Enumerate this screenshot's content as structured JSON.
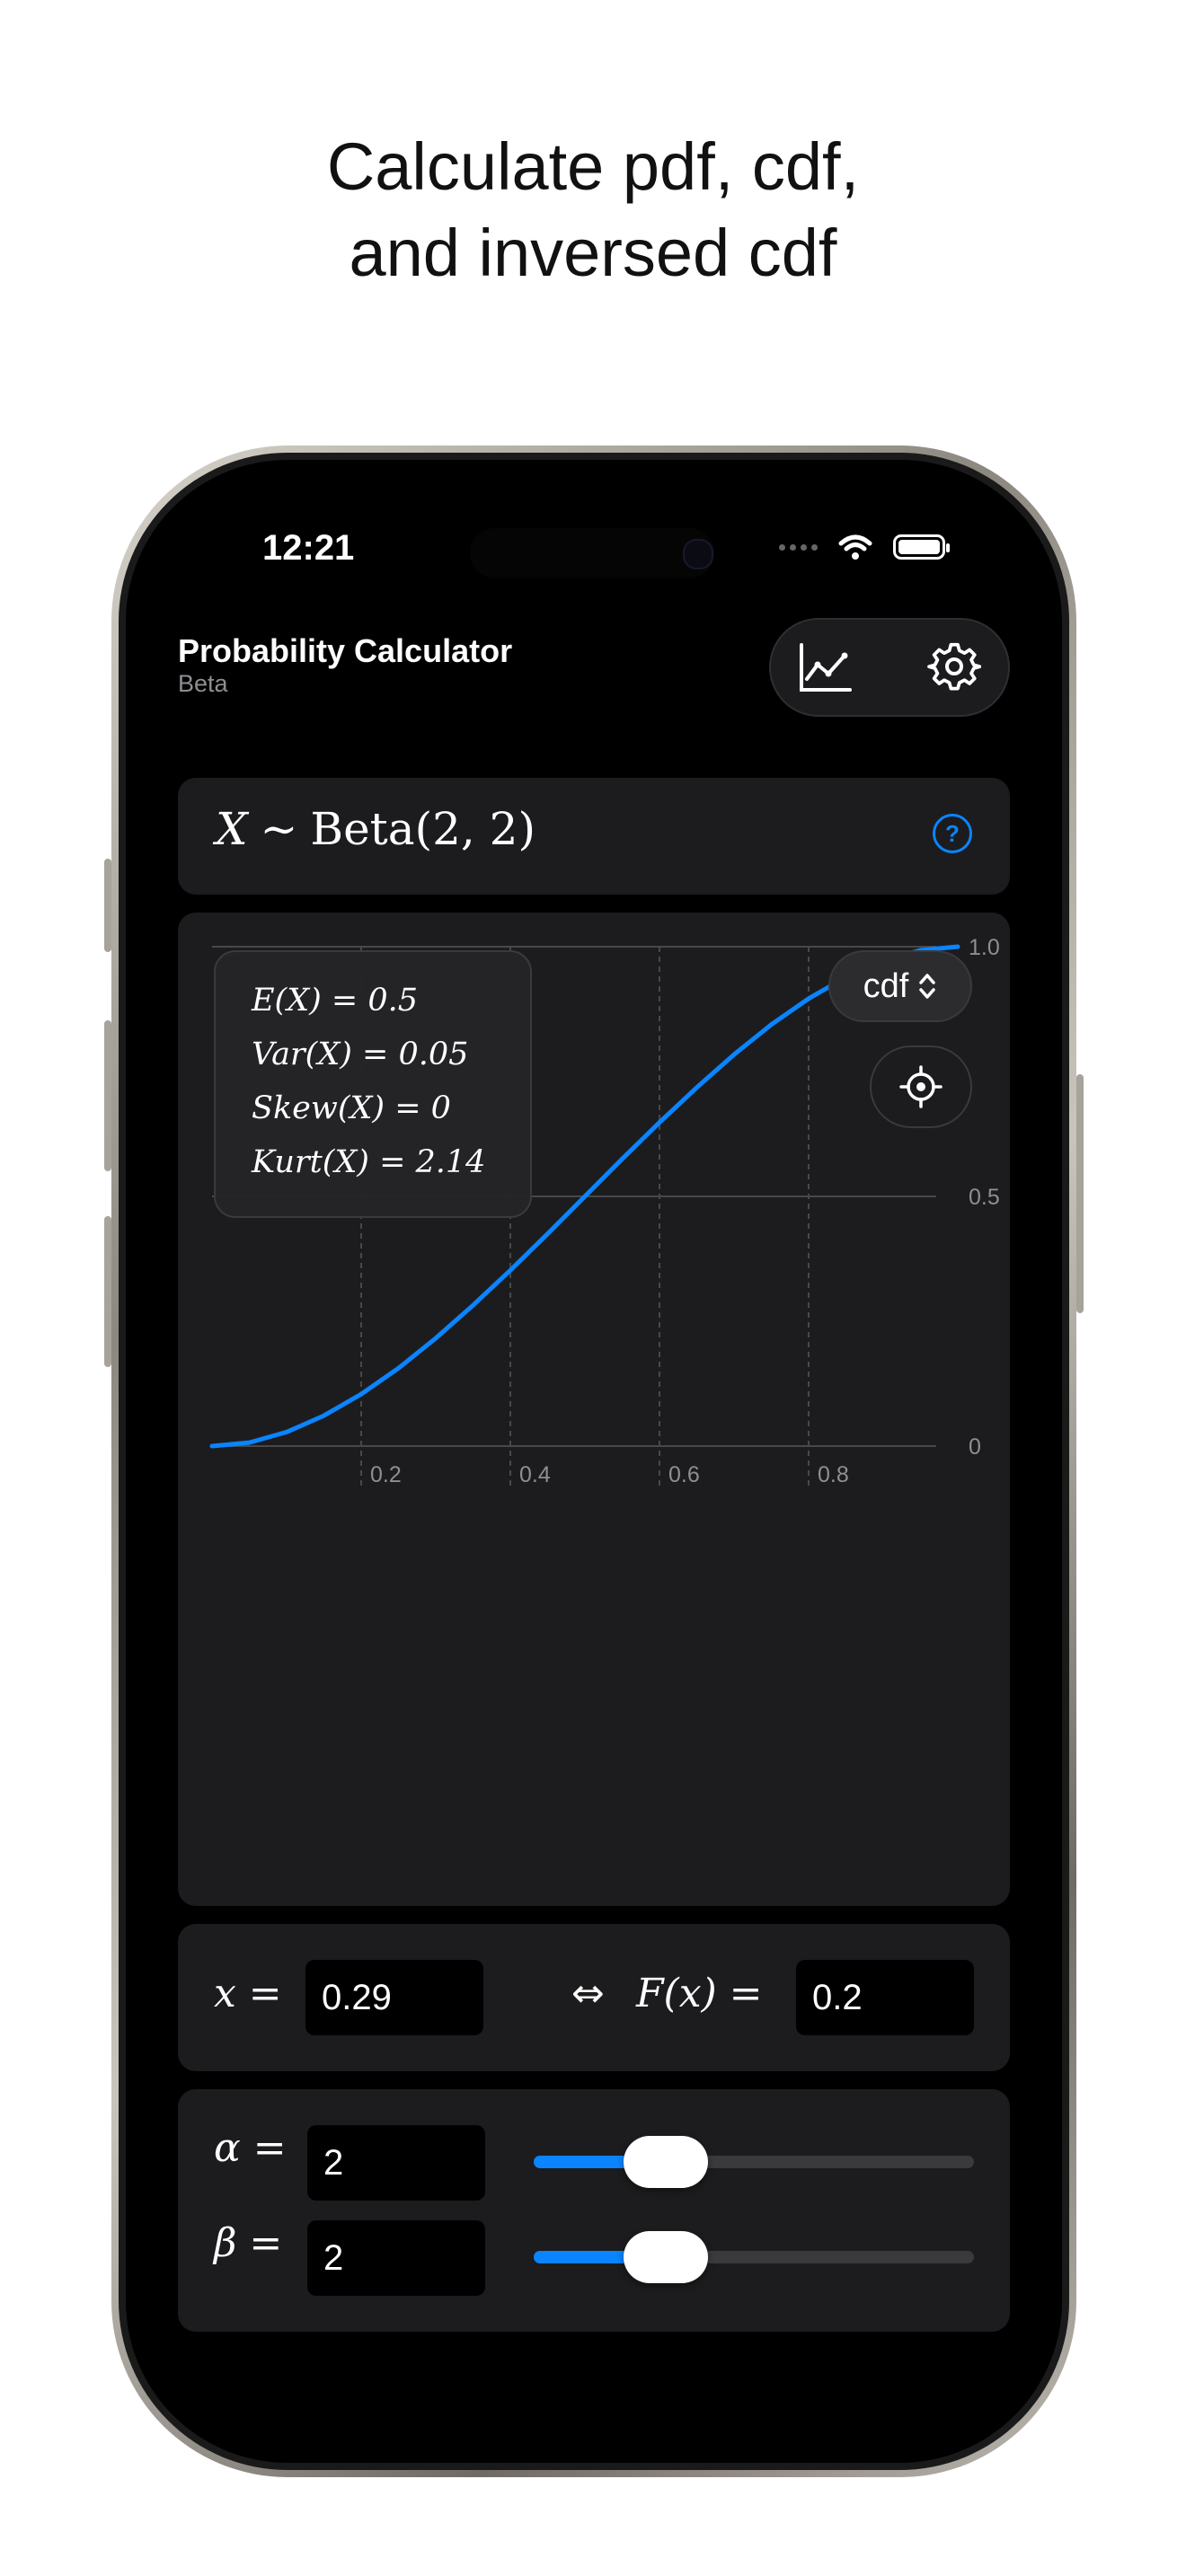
{
  "marketing": {
    "headline_line1": "Calculate pdf, cdf,",
    "headline_line2": "and inversed cdf"
  },
  "status_bar": {
    "time": "12:21"
  },
  "nav": {
    "title": "Probability Calculator",
    "subtitle": "Beta",
    "chart_icon": "line-chart-icon",
    "settings_icon": "gear-icon"
  },
  "distribution": {
    "formula_var": "X",
    "formula_sim": "∼",
    "formula_body": "Beta(2, 2)",
    "help_icon": "question-circle-icon",
    "help_glyph": "?"
  },
  "stats": {
    "mean": "E(X) = 0.5",
    "variance": "Var(X) = 0.05",
    "skew": "Skew(X) = 0",
    "kurtosis": "Kurt(X) = 2.14"
  },
  "chart_controls": {
    "mode_label": "cdf",
    "mode_icon": "chevron-up-down-icon",
    "mode_glyph": "⌃⌄",
    "target_icon": "crosshair-icon"
  },
  "chart_data": {
    "type": "line",
    "series": [
      {
        "x": [
          0.0,
          0.05,
          0.1,
          0.15,
          0.2,
          0.25,
          0.3,
          0.35,
          0.4,
          0.45,
          0.5,
          0.55,
          0.6,
          0.65,
          0.7,
          0.75,
          0.8,
          0.85,
          0.9,
          0.95,
          1.0
        ],
        "y": [
          0.0,
          0.007,
          0.028,
          0.061,
          0.104,
          0.156,
          0.216,
          0.282,
          0.352,
          0.425,
          0.5,
          0.575,
          0.648,
          0.718,
          0.784,
          0.844,
          0.896,
          0.939,
          0.972,
          0.993,
          1.0
        ]
      }
    ],
    "x_ticks": [
      "0.2",
      "0.4",
      "0.6",
      "0.8"
    ],
    "y_ticks": [
      "0",
      "0.5",
      "1.0"
    ],
    "xlim": [
      0,
      1
    ],
    "ylim": [
      0,
      1
    ],
    "grid": true,
    "line_color": "#0a84ff"
  },
  "inverse": {
    "x_label": "x =",
    "x_value": "0.29",
    "arrow": "⇔",
    "f_label": "F(x) =",
    "f_value": "0.2"
  },
  "params": {
    "alpha_label": "α =",
    "alpha_value": "2",
    "alpha_slider_level": 0.3,
    "beta_label": "β =",
    "beta_value": "2",
    "beta_slider_level": 0.3
  },
  "colors": {
    "accent": "#0a84ff",
    "card": "#1c1c1e",
    "background": "#000000"
  }
}
